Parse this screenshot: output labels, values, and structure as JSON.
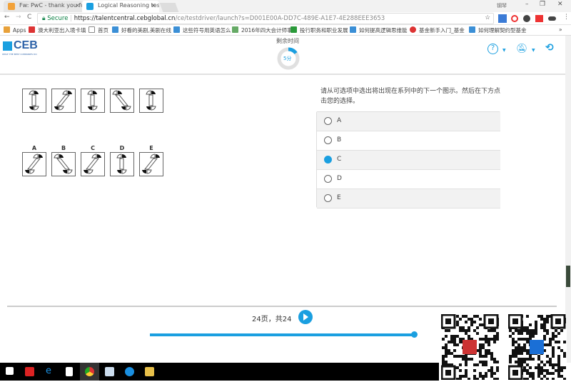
{
  "browser": {
    "tabs": [
      {
        "title": "Fw: PwC - thank you fo"
      },
      {
        "title": "Logical Reasoning test |"
      }
    ],
    "window_user": "钢琴",
    "secure_label": "Secure",
    "url_host": "https://talentcentral.cebglobal.cn",
    "url_path": "/ce/testdriver/launch?s=D001E00A-DD7C-489E-A1E7-4E288EEE3653",
    "bookmarks": [
      "Apps",
      "澳大利亚出入境卡填",
      "首页",
      "好看的美剧,美剧在线",
      "这些符号用英语怎么",
      "2016年四大会计师事",
      "投行职务和职业发展",
      "如何提高逻辑思维能",
      "基金新手入门_基金",
      "如何理解契约型基金"
    ]
  },
  "app": {
    "logo": "CEB",
    "tagline": "WHAT THE BEST COMPANIES DO",
    "timer_label": "剩余时间",
    "timer_value": "5分",
    "timer_fraction": 0.15,
    "accent": "#1a9fe0"
  },
  "question": {
    "prompt": "请从可选项中选出将出现在系列中的下一个图示。然后在下方点击您的选择。",
    "answer_labels": [
      "A",
      "B",
      "C",
      "D",
      "E"
    ],
    "options": [
      {
        "label": "A",
        "selected": false
      },
      {
        "label": "B",
        "selected": false
      },
      {
        "label": "C",
        "selected": true
      },
      {
        "label": "D",
        "selected": false
      },
      {
        "label": "E",
        "selected": false
      }
    ]
  },
  "footer": {
    "page_text": "24页，共24",
    "page_current": "24",
    "page_sep": "页，共",
    "page_total": "24",
    "progress": 1.0
  }
}
